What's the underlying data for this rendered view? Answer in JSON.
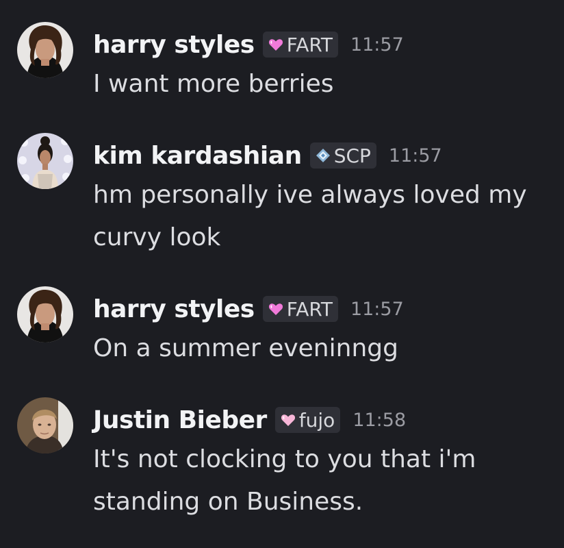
{
  "colors": {
    "background": "#1c1d22",
    "username": "#f2f3f5",
    "message_text": "#dcdde1",
    "timestamp": "#9b9ca3",
    "tag_background": "#2f3037",
    "heart_pink": "#f07ad9",
    "heart_light": "#f7b6d8",
    "diamond_blue": "#8fb8d9"
  },
  "messages": [
    {
      "author": "harry styles",
      "tag": "FART",
      "tag_icon": "pink-heart-icon",
      "time": "11:57",
      "text": "I want more berries",
      "avatar": "harry-styles-avatar"
    },
    {
      "author": "kim kardashian",
      "tag": "SCP",
      "tag_icon": "diamond-sparkle-icon",
      "time": "11:57",
      "text": "hm personally ive always loved my curvy look",
      "avatar": "kim-kardashian-avatar"
    },
    {
      "author": "harry styles",
      "tag": "FART",
      "tag_icon": "pink-heart-icon",
      "time": "11:57",
      "text": "On a summer eveninngg",
      "avatar": "harry-styles-avatar"
    },
    {
      "author": "Justin Bieber",
      "tag": "fujo",
      "tag_icon": "light-pink-heart-icon",
      "time": "11:58",
      "text": "It's not clocking to you that i'm standing on Business.",
      "avatar": "justin-bieber-avatar"
    }
  ]
}
